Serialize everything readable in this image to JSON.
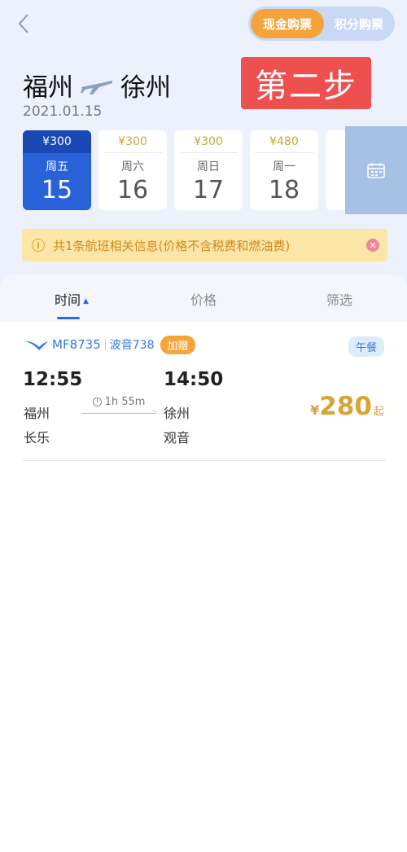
{
  "header": {
    "back_icon": "chevron-left-icon",
    "toggle": {
      "active_label": "现金购票",
      "inactive_label": "积分购票"
    },
    "origin": "福州",
    "destination": "徐州",
    "plane_icon": "airplane-icon",
    "date": "2021.01.15",
    "step_label": "第二步"
  },
  "date_selector": {
    "days": [
      {
        "price": "¥300",
        "weekday": "周五",
        "day": "15",
        "active": true
      },
      {
        "price": "¥300",
        "weekday": "周六",
        "day": "16",
        "active": false
      },
      {
        "price": "¥300",
        "weekday": "周日",
        "day": "17",
        "active": false
      },
      {
        "price": "¥480",
        "weekday": "周一",
        "day": "18",
        "active": false
      }
    ],
    "calendar_icon": "calendar-icon"
  },
  "notice": {
    "text": "共1条航班相关信息(价格不含税费和燃油费)",
    "info_icon": "info-icon",
    "close_icon": "close-icon"
  },
  "filter_tabs": {
    "time": "时间",
    "price": "价格",
    "filter": "筛选"
  },
  "flights": [
    {
      "flight_no": "MF8735",
      "aircraft": "波音738",
      "bonus": "加赠",
      "meal": "午餐",
      "dep_time": "12:55",
      "arr_time": "14:50",
      "duration": "1h 55m",
      "dep_city": "福州",
      "dep_airport": "长乐",
      "arr_city": "徐州",
      "arr_airport": "观音",
      "currency": "¥",
      "price": "280",
      "price_suffix": "起"
    }
  ],
  "colors": {
    "primary_blue": "#2962d8",
    "accent_orange": "#f6a43a",
    "price_gold": "#d9a335",
    "step_red": "#ee4f4f",
    "notice_bg": "#fbe6a8"
  }
}
